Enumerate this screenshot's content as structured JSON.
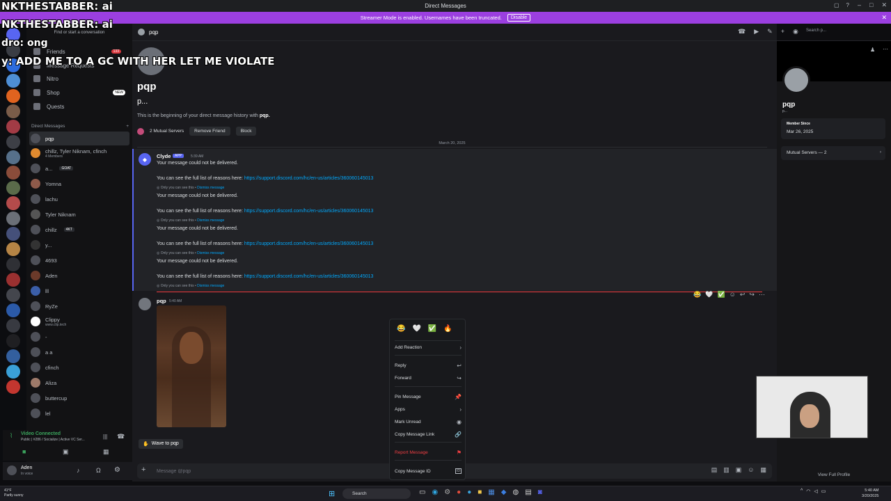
{
  "window": {
    "title": "Direct Messages"
  },
  "streamer_banner": {
    "text": "Streamer Mode is enabled. Usernames have been truncated.",
    "disable_label": "Disable"
  },
  "overlay": {
    "line1": "NKTHESTABBER: ai",
    "line2": "NKTHESTABBER: ai",
    "line3": "dro: ong",
    "line4": "y: ADD ME TO A GC WITH HER LET ME VIOLATE"
  },
  "sidebar": {
    "search_placeholder": "Find or start a conversation",
    "nav": [
      {
        "label": "Friends",
        "badge": "133"
      },
      {
        "label": "Message Requests",
        "badge": ""
      },
      {
        "label": "Nitro",
        "badge": ""
      },
      {
        "label": "Shop",
        "badge": "NEW"
      },
      {
        "label": "Quests",
        "badge": ""
      }
    ],
    "dm_header": "Direct Messages",
    "dm_add": "+",
    "dms": [
      {
        "name": "pqp",
        "sub": "",
        "tag": ""
      },
      {
        "name": "chillz, Tyler Niknam, cfinch",
        "sub": "4 Members",
        "tag": ""
      },
      {
        "name": "a...",
        "sub": "",
        "tag": "GOAT"
      },
      {
        "name": "Yomna",
        "sub": "",
        "tag": ""
      },
      {
        "name": "lachu",
        "sub": "",
        "tag": ""
      },
      {
        "name": "Tyler Niknam",
        "sub": "",
        "tag": ""
      },
      {
        "name": "chillz",
        "sub": "",
        "tag": "4KT"
      },
      {
        "name": "y...",
        "sub": "",
        "tag": ""
      },
      {
        "name": "4693",
        "sub": "",
        "tag": ""
      },
      {
        "name": "Aden",
        "sub": "",
        "tag": ""
      },
      {
        "name": "lll",
        "sub": "",
        "tag": ""
      },
      {
        "name": "RyZe",
        "sub": "",
        "tag": ""
      },
      {
        "name": "Clippy",
        "sub": "www.clip.tech",
        "tag": ""
      },
      {
        "name": "-",
        "sub": "",
        "tag": ""
      },
      {
        "name": "a a",
        "sub": "",
        "tag": ""
      },
      {
        "name": "cfinch",
        "sub": "",
        "tag": ""
      },
      {
        "name": "Aliza",
        "sub": "",
        "tag": ""
      },
      {
        "name": "buttercup",
        "sub": "",
        "tag": ""
      },
      {
        "name": "lel",
        "sub": "",
        "tag": ""
      }
    ]
  },
  "voice": {
    "status": "Video Connected",
    "channel": "Public | #286 / Socialize | Active VC Ser..."
  },
  "user": {
    "name": "Aden",
    "status": "In voice"
  },
  "chat": {
    "header_name": "pqp",
    "search_placeholder": "Search p...",
    "intro_name": "pqp",
    "intro_sub": "p...",
    "intro_text_prefix": "This is the beginning of your direct message history with ",
    "intro_text_name": "pqp.",
    "mutual_servers": "2 Mutual Servers",
    "remove_friend": "Remove Friend",
    "block": "Block",
    "date_divider": "March 20, 2025"
  },
  "clyde": {
    "name": "Clyde",
    "app_tag": "APP",
    "time": "5:39 AM",
    "not_delivered": "Your message could not be delivered.",
    "reasons_prefix": "You can see the full list of reasons here: ",
    "reasons_link": "https://support.discord.com/hc/en-us/articles/360060145013",
    "only_you": "Only you can see this • ",
    "dismiss": "Dismiss message"
  },
  "message": {
    "author": "pqp",
    "time": "5:40 AM"
  },
  "composer": {
    "wave_label": "Wave to pqp",
    "placeholder": "Message @pqp"
  },
  "context_menu": {
    "quick_reactions": [
      "😂",
      "🤍",
      "✅",
      "🔥"
    ],
    "items": [
      {
        "label": "Add Reaction",
        "icon": "›"
      },
      {
        "label": "Reply",
        "icon": "↩"
      },
      {
        "label": "Forward",
        "icon": "↪"
      },
      {
        "label": "Pin Message",
        "icon": "📌"
      },
      {
        "label": "Apps",
        "icon": "›"
      },
      {
        "label": "Mark Unread",
        "icon": "◉"
      },
      {
        "label": "Copy Message Link",
        "icon": "🔗"
      },
      {
        "label": "Report Message",
        "icon": "⚑"
      },
      {
        "label": "Copy Message ID",
        "icon": "ID"
      }
    ]
  },
  "profile": {
    "name": "pqp",
    "handle": "p...",
    "member_since_label": "Member Since",
    "member_since": "Mar 26, 2025",
    "mutual_servers": "Mutual Servers — 2",
    "view_full": "View Full Profile"
  },
  "taskbar": {
    "weather_temp": "41°F",
    "weather_desc": "Partly sunny",
    "search_label": "Search",
    "time": "5:40 AM",
    "date": "3/20/2025"
  },
  "colors": {
    "accent": "#5865f2",
    "banner": "#9b3fe0",
    "danger": "#f23f43",
    "link": "#00a8fc",
    "voice": "#3ba55d"
  }
}
